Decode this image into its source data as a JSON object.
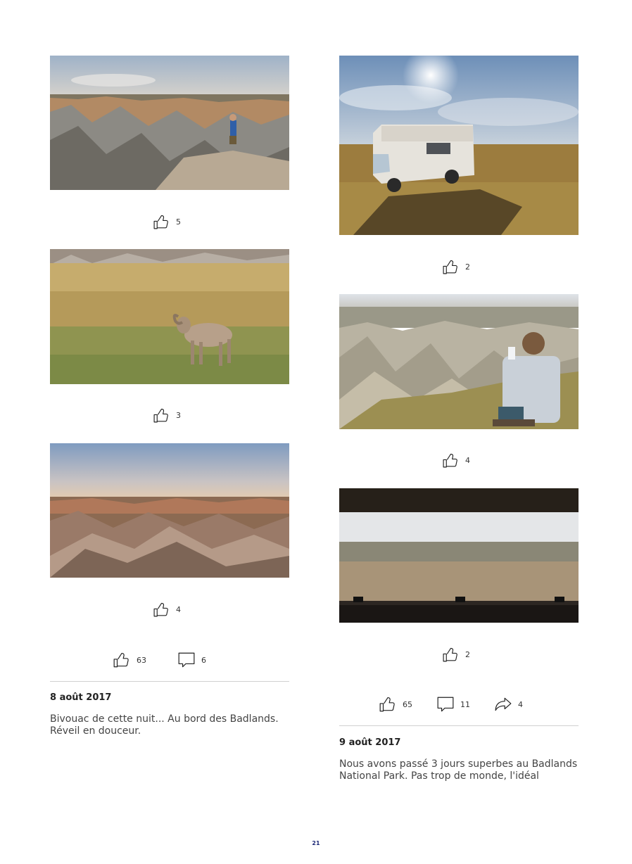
{
  "left_column": {
    "photos": [
      {
        "description": "badlands-viewpoint-person",
        "likes": "5"
      },
      {
        "description": "bighorn-sheep-grassland",
        "likes": "3"
      },
      {
        "description": "badlands-sunset",
        "likes": "4"
      }
    ],
    "post": {
      "likes": "63",
      "comments": "6",
      "date": "8 août 2017",
      "text": "Bivouac de cette nuit... Au bord des Badlands. Réveil en douceur."
    }
  },
  "right_column": {
    "photos": [
      {
        "description": "camper-van-on-plateau",
        "likes": "2"
      },
      {
        "description": "man-sitting-overlooking-badlands",
        "likes": "4"
      },
      {
        "description": "view-from-van-window",
        "likes": "2"
      }
    ],
    "post": {
      "likes": "65",
      "comments": "11",
      "shares": "4",
      "date": "9 août 2017",
      "text": "Nous avons passé 3 jours superbes au Badlands National Park. Pas trop de monde, l'idéal"
    }
  },
  "page_number": "21",
  "icons": {
    "like": "thumbs-up-icon",
    "comment": "speech-bubble-icon",
    "share": "share-arrow-icon"
  }
}
